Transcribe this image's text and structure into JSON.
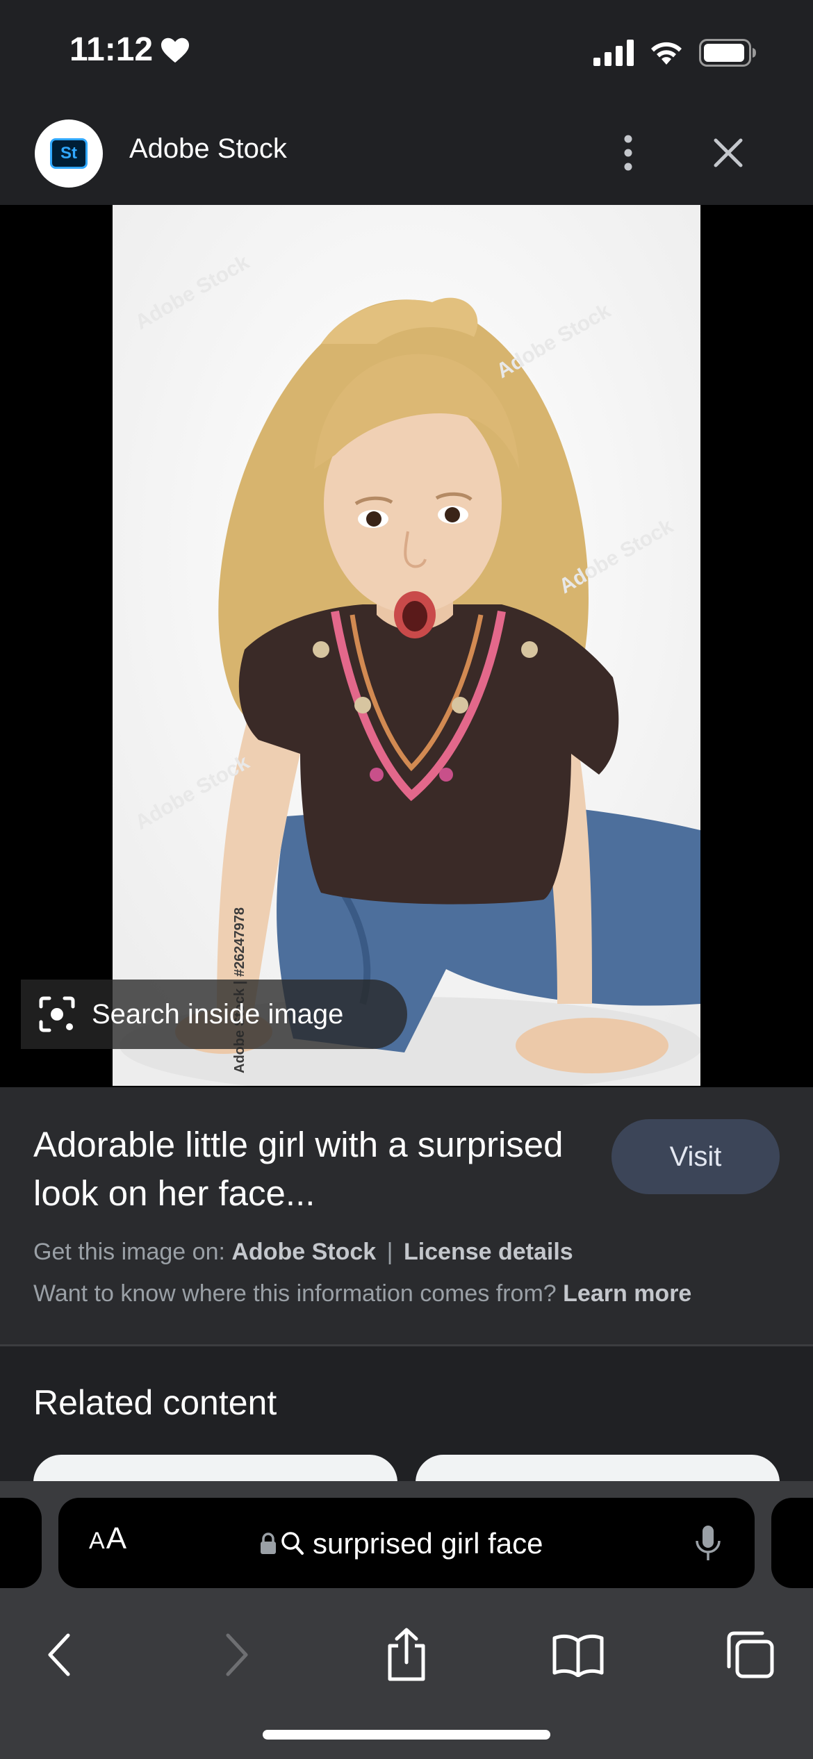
{
  "status_bar": {
    "time": "11:12",
    "time_icon": "heart-icon",
    "icons": [
      "cellular-signal-icon",
      "wifi-icon",
      "battery-icon"
    ]
  },
  "header": {
    "logo_text": "St",
    "title": "Adobe Stock",
    "more_icon": "more-vert-icon",
    "close_icon": "close-icon"
  },
  "image": {
    "watermark_id": "Adobe Stock | #26247978",
    "lens_label": "Search inside image"
  },
  "info": {
    "title": "Adorable little girl with a surprised look on her face...",
    "visit_label": "Visit",
    "source_prefix": "Get this image on: ",
    "source_name": "Adobe Stock",
    "separator": "|",
    "license_link": "License details",
    "learn_prefix": "Want to know where this information comes from? ",
    "learn_link": "Learn more"
  },
  "related": {
    "title": "Related content"
  },
  "browser": {
    "aa_small": "A",
    "aa_large": "A",
    "url_text": "surprised girl face",
    "lock_icon": "lock-icon",
    "search_icon": "search-icon",
    "mic_icon": "microphone-icon"
  },
  "toolbar": {
    "items": [
      "back-icon",
      "forward-icon",
      "share-icon",
      "bookmarks-icon",
      "tabs-icon"
    ]
  },
  "colors": {
    "background": "#202124",
    "panel": "#2a2b2e",
    "visit_button": "#3c4558",
    "address_bar": "#3a3b3e"
  }
}
